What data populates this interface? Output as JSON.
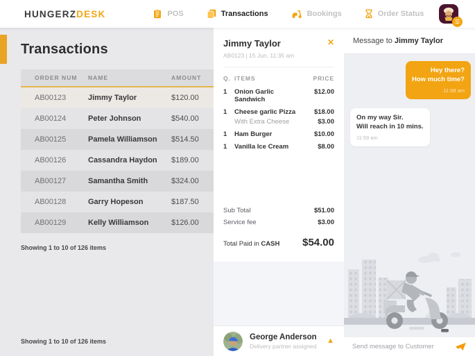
{
  "brand": {
    "primary": "HUNGERZ",
    "secondary": "DESK"
  },
  "nav": {
    "items": [
      {
        "label": "POS",
        "icon": "pos-icon",
        "active": false
      },
      {
        "label": "Transactions",
        "icon": "transactions-icon",
        "active": true
      },
      {
        "label": "Bookings",
        "icon": "bookings-icon",
        "active": false
      },
      {
        "label": "Order Status",
        "icon": "order-status-icon",
        "active": false
      }
    ]
  },
  "icons": {
    "close": "✕",
    "expand": "▲",
    "menu": "☰"
  },
  "transactions": {
    "title": "Transactions",
    "columns": {
      "order_num": "ORDER NUM",
      "name": "NAME",
      "amount": "AMOUNT"
    },
    "rows": [
      {
        "order_num": "AB00123",
        "name": "Jimmy Taylor",
        "amount": "$120.00"
      },
      {
        "order_num": "AB00124",
        "name": "Peter Johnson",
        "amount": "$540.00"
      },
      {
        "order_num": "AB00125",
        "name": "Pamela Williamson",
        "amount": "$514.50"
      },
      {
        "order_num": "AB00126",
        "name": "Cassandra Haydon",
        "amount": "$189.00"
      },
      {
        "order_num": "AB00127",
        "name": "Samantha Smith",
        "amount": "$324.00"
      },
      {
        "order_num": "AB00128",
        "name": "Garry Hopeson",
        "amount": "$187.50"
      },
      {
        "order_num": "AB00129",
        "name": "Kelly Williamson",
        "amount": "$126.00"
      }
    ],
    "selected_row": 0,
    "showing_top": "Showing 1 to 10 of 126 items",
    "showing_bottom": "Showing 1 to 10 of 126 items"
  },
  "order_detail": {
    "customer_name": "Jimmy Taylor",
    "meta": "AB0123 | 15 Jun, 11:35 am",
    "columns": {
      "qty": "Q.",
      "items": "ITEMS",
      "price": "PRICE"
    },
    "items": [
      {
        "qty": "1",
        "name": "Onion Garlic Sandwich",
        "price": "$12.00"
      },
      {
        "qty": "1",
        "name": "Cheese garlic Pizza",
        "price": "$18.00"
      },
      {
        "qty": "",
        "name": "With Extra Cheese",
        "price": "$3.00"
      },
      {
        "qty": "1",
        "name": "Ham Burger",
        "price": "$10.00"
      },
      {
        "qty": "1",
        "name": "Vanilla Ice Cream",
        "price": "$8.00"
      }
    ],
    "totals": {
      "sub_total_label": "Sub Total",
      "sub_total": "$51.00",
      "service_fee_label": "Service fee",
      "service_fee": "$3.00",
      "total_label": "Total Paid in",
      "total_method": "CASH",
      "total": "$54.00"
    },
    "delivery": {
      "name": "George Anderson",
      "status": "Delivery partner assigned"
    }
  },
  "chat": {
    "header_prefix": "Message to",
    "header_name": "Jimmy Taylor",
    "messages": [
      {
        "from": "staff",
        "line1": "Hey there?",
        "line2": "How much time?",
        "time": "11:58 am"
      },
      {
        "from": "customer",
        "line1": "On my way Sir.",
        "line2": "Will reach in 10 mins.",
        "time": "11:59 am"
      }
    ],
    "input_placeholder": "Send message to Customer"
  },
  "colors": {
    "accent": "#F2A615",
    "accent_bar": "#E9A426",
    "bubble_out": "#F2A412"
  }
}
